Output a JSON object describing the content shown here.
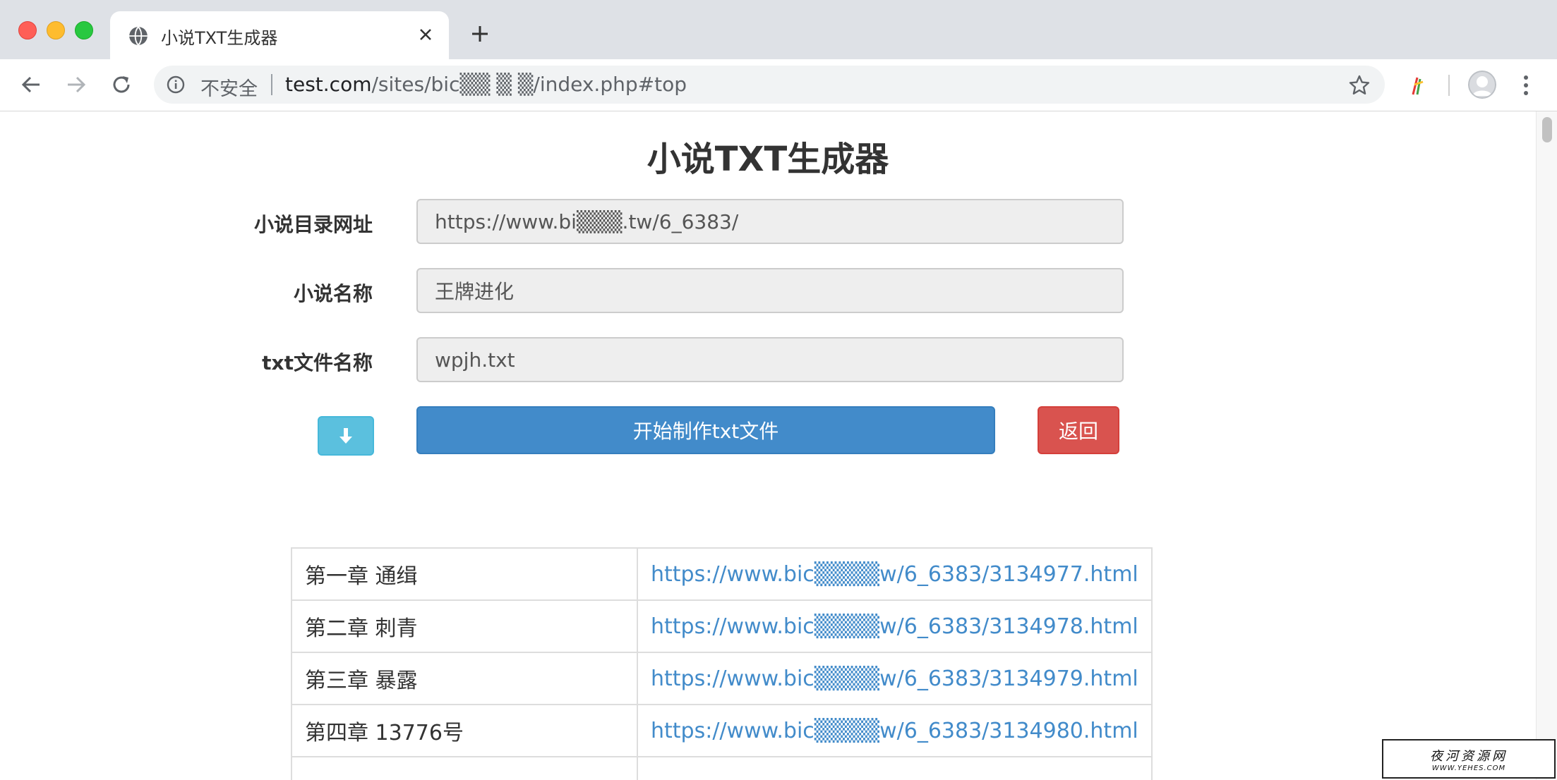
{
  "browser": {
    "tab": {
      "title": "小说TXT生成器",
      "close_label": "×",
      "new_tab_label": "+"
    },
    "address_bar": {
      "security_text": "不安全",
      "url_host": "test.com",
      "url_path": "/sites/bic▒▒ ▒ ▒/index.php#top"
    },
    "icons": {
      "favicon": "globe-icon",
      "back": "arrow-left-icon",
      "forward": "arrow-right-icon",
      "reload": "reload-icon",
      "info": "info-icon",
      "bookmark": "star-icon",
      "extension": "extension-icon",
      "profile": "avatar-icon",
      "menu": "kebab-menu-icon"
    }
  },
  "page": {
    "title": "小说TXT生成器",
    "form": {
      "url_label": "小说目录网址",
      "url_value": "https://www.bi▒▒▒.tw/6_6383/",
      "name_label": "小说名称",
      "name_value": "王牌进化",
      "file_label": "txt文件名称",
      "file_value": "wpjh.txt"
    },
    "buttons": {
      "down_icon": "arrow-down-icon",
      "start_label": "开始制作txt文件",
      "back_label": "返回"
    },
    "chapters": [
      {
        "title": "第一章 通缉",
        "url": "https://www.bic▒▒▒▒w/6_6383/3134977.html"
      },
      {
        "title": "第二章 刺青",
        "url": "https://www.bic▒▒▒▒w/6_6383/3134978.html"
      },
      {
        "title": "第三章 暴露",
        "url": "https://www.bic▒▒▒▒w/6_6383/3134979.html"
      },
      {
        "title": "第四章 13776号",
        "url": "https://www.bic▒▒▒▒w/6_6383/3134980.html"
      }
    ]
  },
  "watermark": {
    "main": "夜河资源网",
    "sub": "WWW.YEHES.COM"
  },
  "colors": {
    "primary": "#428bca",
    "danger": "#d9534f",
    "info": "#5bc0de",
    "link": "#428bca"
  }
}
